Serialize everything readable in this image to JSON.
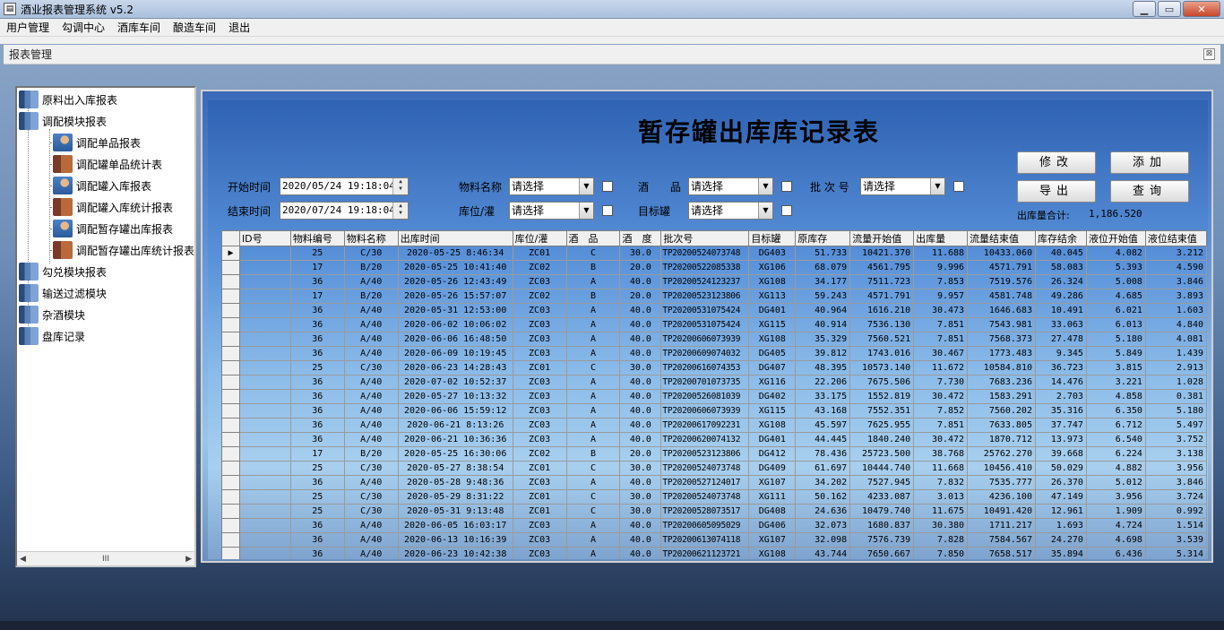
{
  "window": {
    "title": "酒业报表管理系统 v5.2"
  },
  "menu": [
    "用户管理",
    "勾调中心",
    "酒库车间",
    "酿造车间",
    "退出"
  ],
  "child_window": {
    "title": "报表管理"
  },
  "tree": {
    "items": [
      {
        "label": "原料出入库报表",
        "level": 0,
        "icon": "book"
      },
      {
        "label": "调配模块报表",
        "level": 0,
        "icon": "book"
      },
      {
        "label": "调配单品报表",
        "level": 1,
        "icon": "person"
      },
      {
        "label": "调配罐单品统计表",
        "level": 1,
        "icon": "folder"
      },
      {
        "label": "调配罐入库报表",
        "level": 1,
        "icon": "person"
      },
      {
        "label": "调配罐入库统计报表",
        "level": 1,
        "icon": "folder"
      },
      {
        "label": "调配暂存罐出库报表",
        "level": 1,
        "icon": "person"
      },
      {
        "label": "调配暂存罐出库统计报表",
        "level": 1,
        "icon": "folder"
      },
      {
        "label": "勾兑模块报表",
        "level": 0,
        "icon": "book"
      },
      {
        "label": "输送过滤模块",
        "level": 0,
        "icon": "book"
      },
      {
        "label": "杂酒模块",
        "level": 0,
        "icon": "book"
      },
      {
        "label": "盘库记录",
        "level": 0,
        "icon": "book"
      }
    ],
    "scroll_glyph": "III"
  },
  "report": {
    "title": "暂存罐出库库记录表",
    "start_label": "开始时间",
    "start_value": "2020/05/24 19:18:04",
    "end_label": "结束时间",
    "end_value": "2020/07/24 19:18:04",
    "material_label": "物料名称",
    "material_value": "请选择",
    "location_label": "库位/灌",
    "location_value": "请选择",
    "wine_label": "酒　　品",
    "wine_value": "请选择",
    "target_label": "目标罐",
    "target_value": "请选择",
    "batch_label": "批 次 号",
    "batch_value": "请选择",
    "btn_modify": "修改",
    "btn_add": "添加",
    "btn_export": "导出",
    "btn_query": "查询",
    "total_label": "出库量合计:",
    "total_value": "1,186.520"
  },
  "table": {
    "columns": [
      "ID号",
      "物料编号",
      "物料名称",
      "出库时间",
      "库位/灌",
      "酒　品",
      "酒　度",
      "批次号",
      "目标罐",
      "原库存",
      "流量开始值",
      "出库量",
      "流量结束值",
      "库存结余",
      "液位开始值",
      "液位结束值"
    ],
    "rows": [
      [
        "",
        "25",
        "C/30",
        "2020-05-25 8:46:34",
        "ZC01",
        "C",
        "30.0",
        "TP20200524073748",
        "DG403",
        "51.733",
        "10421.370",
        "11.688",
        "10433.060",
        "40.045",
        "4.082",
        "3.212"
      ],
      [
        "",
        "17",
        "B/20",
        "2020-05-25 10:41:40",
        "ZC02",
        "B",
        "20.0",
        "TP20200522085338",
        "XG106",
        "68.079",
        "4561.795",
        "9.996",
        "4571.791",
        "58.083",
        "5.393",
        "4.590"
      ],
      [
        "",
        "36",
        "A/40",
        "2020-05-26 12:43:49",
        "ZC03",
        "A",
        "40.0",
        "TP20200524123237",
        "XG108",
        "34.177",
        "7511.723",
        "7.853",
        "7519.576",
        "26.324",
        "5.008",
        "3.846"
      ],
      [
        "",
        "17",
        "B/20",
        "2020-05-26 15:57:07",
        "ZC02",
        "B",
        "20.0",
        "TP20200523123806",
        "XG113",
        "59.243",
        "4571.791",
        "9.957",
        "4581.748",
        "49.286",
        "4.685",
        "3.893"
      ],
      [
        "",
        "36",
        "A/40",
        "2020-05-31 12:53:00",
        "ZC03",
        "A",
        "40.0",
        "TP20200531075424",
        "DG401",
        "40.964",
        "1616.210",
        "30.473",
        "1646.683",
        "10.491",
        "6.021",
        "1.603"
      ],
      [
        "",
        "36",
        "A/40",
        "2020-06-02 10:06:02",
        "ZC03",
        "A",
        "40.0",
        "TP20200531075424",
        "XG115",
        "40.914",
        "7536.130",
        "7.851",
        "7543.981",
        "33.063",
        "6.013",
        "4.840"
      ],
      [
        "",
        "36",
        "A/40",
        "2020-06-06 16:48:50",
        "ZC03",
        "A",
        "40.0",
        "TP20200606073939",
        "XG108",
        "35.329",
        "7560.521",
        "7.851",
        "7568.373",
        "27.478",
        "5.180",
        "4.081"
      ],
      [
        "",
        "36",
        "A/40",
        "2020-06-09 10:19:45",
        "ZC03",
        "A",
        "40.0",
        "TP20200609074032",
        "DG405",
        "39.812",
        "1743.016",
        "30.467",
        "1773.483",
        "9.345",
        "5.849",
        "1.439"
      ],
      [
        "",
        "25",
        "C/30",
        "2020-06-23 14:28:43",
        "ZC01",
        "C",
        "30.0",
        "TP20200616074353",
        "DG407",
        "48.395",
        "10573.140",
        "11.672",
        "10584.810",
        "36.723",
        "3.815",
        "2.913"
      ],
      [
        "",
        "36",
        "A/40",
        "2020-07-02 10:52:37",
        "ZC03",
        "A",
        "40.0",
        "TP20200701073735",
        "XG116",
        "22.206",
        "7675.506",
        "7.730",
        "7683.236",
        "14.476",
        "3.221",
        "1.028"
      ],
      [
        "",
        "36",
        "A/40",
        "2020-05-27 10:13:32",
        "ZC03",
        "A",
        "40.0",
        "TP20200526081039",
        "DG402",
        "33.175",
        "1552.819",
        "30.472",
        "1583.291",
        "2.703",
        "4.858",
        "0.381"
      ],
      [
        "",
        "36",
        "A/40",
        "2020-06-06 15:59:12",
        "ZC03",
        "A",
        "40.0",
        "TP20200606073939",
        "XG115",
        "43.168",
        "7552.351",
        "7.852",
        "7560.202",
        "35.316",
        "6.350",
        "5.180"
      ],
      [
        "",
        "36",
        "A/40",
        "2020-06-21 8:13:26",
        "ZC03",
        "A",
        "40.0",
        "TP20200617092231",
        "XG108",
        "45.597",
        "7625.955",
        "7.851",
        "7633.805",
        "37.747",
        "6.712",
        "5.497"
      ],
      [
        "",
        "36",
        "A/40",
        "2020-06-21 10:36:36",
        "ZC03",
        "A",
        "40.0",
        "TP20200620074132",
        "DG401",
        "44.445",
        "1840.240",
        "30.472",
        "1870.712",
        "13.973",
        "6.540",
        "3.752"
      ],
      [
        "",
        "17",
        "B/20",
        "2020-05-25 16:30:06",
        "ZC02",
        "B",
        "20.0",
        "TP20200523123806",
        "DG412",
        "78.436",
        "25723.500",
        "38.768",
        "25762.270",
        "39.668",
        "6.224",
        "3.138"
      ],
      [
        "",
        "25",
        "C/30",
        "2020-05-27 8:38:54",
        "ZC01",
        "C",
        "30.0",
        "TP20200524073748",
        "DG409",
        "61.697",
        "10444.740",
        "11.668",
        "10456.410",
        "50.029",
        "4.882",
        "3.956"
      ],
      [
        "",
        "36",
        "A/40",
        "2020-05-28 9:48:36",
        "ZC03",
        "A",
        "40.0",
        "TP20200527124017",
        "XG107",
        "34.202",
        "7527.945",
        "7.832",
        "7535.777",
        "26.370",
        "5.012",
        "3.846"
      ],
      [
        "",
        "25",
        "C/30",
        "2020-05-29 8:31:22",
        "ZC01",
        "C",
        "30.0",
        "TP20200524073748",
        "XG111",
        "50.162",
        "4233.087",
        "3.013",
        "4236.100",
        "47.149",
        "3.956",
        "3.724"
      ],
      [
        "",
        "25",
        "C/30",
        "2020-05-31 9:13:48",
        "ZC01",
        "C",
        "30.0",
        "TP20200528073517",
        "DG408",
        "24.636",
        "10479.740",
        "11.675",
        "10491.420",
        "12.961",
        "1.909",
        "0.992"
      ],
      [
        "",
        "36",
        "A/40",
        "2020-06-05 16:03:17",
        "ZC03",
        "A",
        "40.0",
        "TP20200605095029",
        "DG406",
        "32.073",
        "1680.837",
        "30.380",
        "1711.217",
        "1.693",
        "4.724",
        "1.514"
      ],
      [
        "",
        "36",
        "A/40",
        "2020-06-13 10:16:39",
        "ZC03",
        "A",
        "40.0",
        "TP20200613074118",
        "XG107",
        "32.098",
        "7576.739",
        "7.828",
        "7584.567",
        "24.270",
        "4.698",
        "3.539"
      ],
      [
        "",
        "36",
        "A/40",
        "2020-06-23 10:42:38",
        "ZC03",
        "A",
        "40.0",
        "TP20200621123721",
        "XG108",
        "43.744",
        "7650.667",
        "7.850",
        "7658.517",
        "35.894",
        "6.436",
        "5.314"
      ]
    ],
    "current_row_marker": "▶"
  }
}
